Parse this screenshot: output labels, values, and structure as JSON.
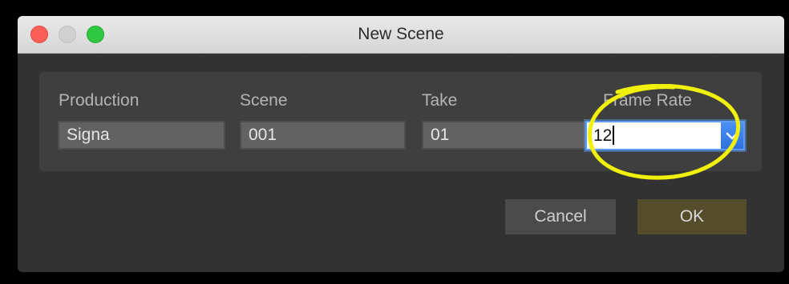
{
  "window": {
    "title": "New Scene",
    "controls": [
      "close",
      "minimize",
      "zoom"
    ]
  },
  "fields": {
    "production": {
      "label": "Production",
      "value": "Signa"
    },
    "scene": {
      "label": "Scene",
      "value": "001"
    },
    "take": {
      "label": "Take",
      "value": "01"
    },
    "frame_rate": {
      "label": "Frame Rate",
      "value": "12"
    }
  },
  "buttons": {
    "cancel_label": "Cancel",
    "ok_label": "OK"
  },
  "colors": {
    "window_bg": "#323232",
    "panel_bg": "#3f3f3f",
    "ok_button": "#544c2a",
    "annotation": "#f0f00c",
    "focus_accent": "#2f72de"
  },
  "icons": {
    "dropdown_arrow": "chevron-down-icon",
    "annotation": "highlight-circle"
  }
}
